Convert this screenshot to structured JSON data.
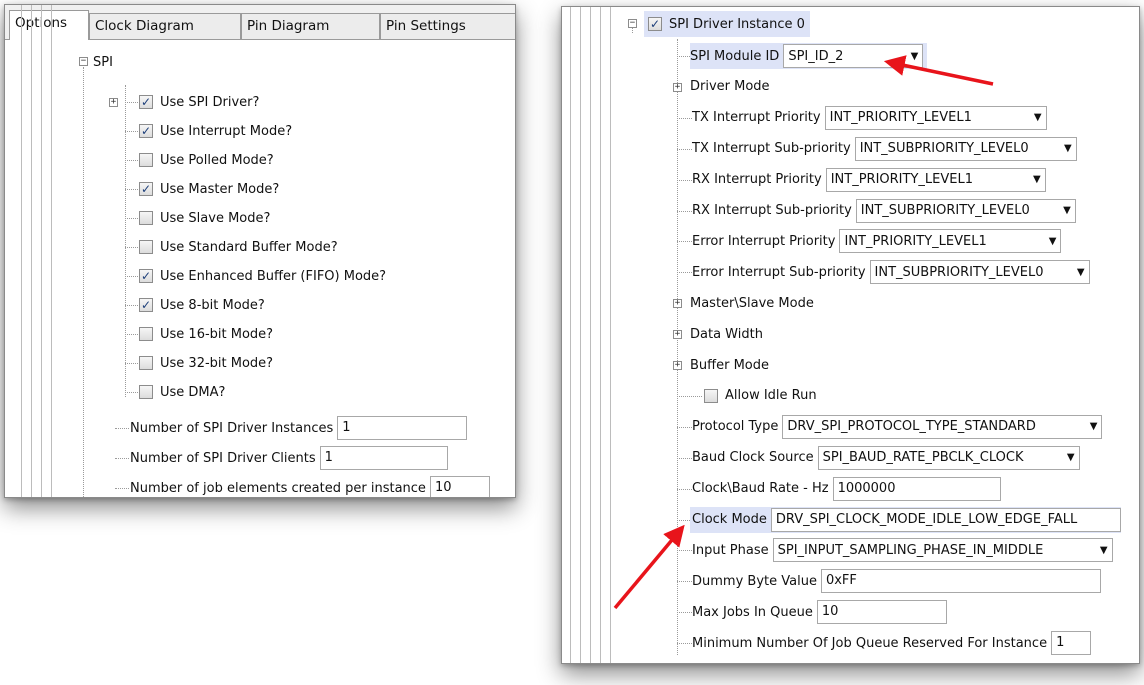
{
  "left_panel": {
    "tabs": [
      {
        "label": "Options",
        "active": true,
        "closable": false
      },
      {
        "label": "Clock Diagram",
        "closable": true
      },
      {
        "label": "Pin Diagram",
        "closable": true
      },
      {
        "label": "Pin Settings",
        "closable": true
      }
    ],
    "close_glyph": "×",
    "tree_root_label": "SPI",
    "checkboxes": [
      {
        "label": "Use SPI Driver?",
        "checked": true,
        "expandable": true
      },
      {
        "label": "Use Interrupt Mode?",
        "checked": true
      },
      {
        "label": "Use Polled Mode?",
        "checked": false
      },
      {
        "label": "Use Master Mode?",
        "checked": true
      },
      {
        "label": "Use Slave Mode?",
        "checked": false
      },
      {
        "label": "Use Standard Buffer Mode?",
        "checked": false
      },
      {
        "label": "Use Enhanced Buffer (FIFO) Mode?",
        "checked": true
      },
      {
        "label": "Use 8-bit Mode?",
        "checked": true
      },
      {
        "label": "Use 16-bit Mode?",
        "checked": false
      },
      {
        "label": "Use 32-bit Mode?",
        "checked": false
      },
      {
        "label": "Use DMA?",
        "checked": false
      }
    ],
    "fields": [
      {
        "label": "Number of SPI Driver Instances",
        "value": "1"
      },
      {
        "label": "Number of SPI Driver Clients",
        "value": "1"
      },
      {
        "label": "Number of job elements created per instance",
        "value": "10"
      }
    ]
  },
  "right_panel": {
    "instance_label": "SPI Driver Instance 0",
    "instance_checked": true,
    "module_id": {
      "label": "SPI Module ID",
      "value": "SPI_ID_2"
    },
    "driver_mode_label": "Driver Mode",
    "priority_rows": [
      {
        "label": "TX Interrupt Priority",
        "value": "INT_PRIORITY_LEVEL1"
      },
      {
        "label": "TX Interrupt Sub-priority",
        "value": "INT_SUBPRIORITY_LEVEL0"
      },
      {
        "label": "RX Interrupt Priority",
        "value": "INT_PRIORITY_LEVEL1"
      },
      {
        "label": "RX Interrupt Sub-priority",
        "value": "INT_SUBPRIORITY_LEVEL0"
      },
      {
        "label": "Error Interrupt Priority",
        "value": "INT_PRIORITY_LEVEL1"
      },
      {
        "label": "Error Interrupt Sub-priority",
        "value": "INT_SUBPRIORITY_LEVEL0"
      }
    ],
    "groups": [
      "Master\\Slave Mode",
      "Data Width",
      "Buffer Mode"
    ],
    "allow_idle_run": {
      "label": "Allow Idle Run",
      "checked": false
    },
    "settings": [
      {
        "label": "Protocol Type",
        "value": "DRV_SPI_PROTOCOL_TYPE_STANDARD",
        "kind": "combo"
      },
      {
        "label": "Baud Clock Source",
        "value": "SPI_BAUD_RATE_PBCLK_CLOCK",
        "kind": "combo"
      },
      {
        "label": "Clock\\Baud Rate - Hz",
        "value": "1000000",
        "kind": "text"
      },
      {
        "label": "Clock Mode",
        "value": "DRV_SPI_CLOCK_MODE_IDLE_LOW_EDGE_FALL",
        "kind": "combo",
        "highlighted": true
      },
      {
        "label": "Input Phase",
        "value": "SPI_INPUT_SAMPLING_PHASE_IN_MIDDLE",
        "kind": "combo"
      },
      {
        "label": "Dummy Byte Value",
        "value": "0xFF",
        "kind": "text"
      },
      {
        "label": "Max Jobs In Queue",
        "value": "10",
        "kind": "text"
      },
      {
        "label": "Minimum Number Of Job Queue Reserved For Instance",
        "value": "1",
        "kind": "text"
      }
    ]
  },
  "colors": {
    "annotation_arrow": "#e8141b",
    "selection_highlight": "#dde3f7",
    "checkmark": "#1d3f7a"
  },
  "glyphs": {
    "check": "✓",
    "dropdown_arrow": "▼",
    "expand_plus": "+",
    "expand_minus": "−"
  }
}
